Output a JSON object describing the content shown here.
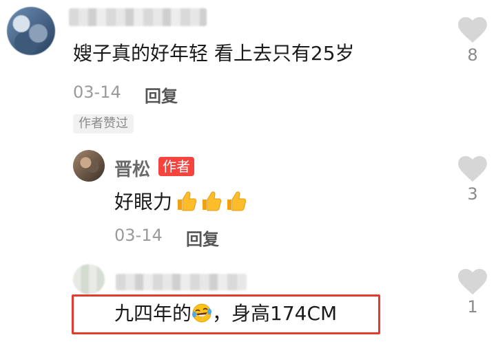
{
  "comments": [
    {
      "text": "嫂子真的好年轻 看上去只有25岁",
      "date": "03-14",
      "reply_label": "回复",
      "liked_by_author_badge": "作者赞过",
      "like_count": "8"
    },
    {
      "author_name": "晋松",
      "author_badge": "作者",
      "text": "好眼力",
      "date": "03-14",
      "reply_label": "回复",
      "like_count": "3"
    },
    {
      "text": "九四年的",
      "text_suffix": "，身高174CM",
      "like_count": "1"
    }
  ],
  "colors": {
    "highlight_border": "#e23a2e",
    "author_badge_bg": "#f5433e",
    "like_icon": "#d6d6d6",
    "meta_text": "#9a9a9a"
  },
  "icons": {
    "like": "heart-icon",
    "thumbs_up": "thumbs-up-icon",
    "laugh": "laughing-tears-icon"
  }
}
